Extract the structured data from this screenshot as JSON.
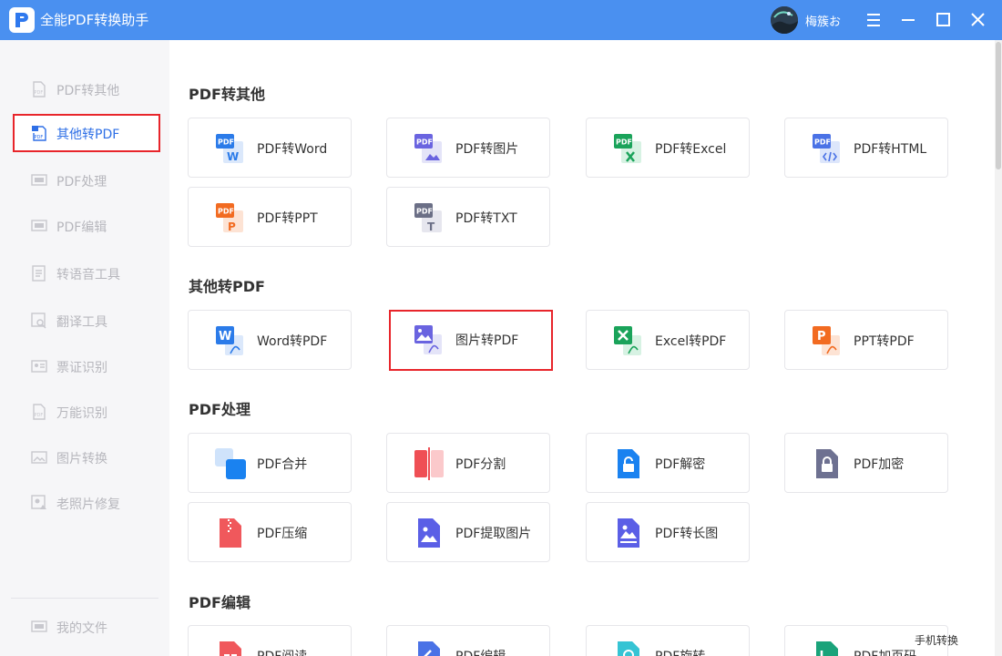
{
  "app": {
    "title": "全能PDF转换助手",
    "user_name": "梅簇お",
    "colors": {
      "title_bar": "#4a90f0",
      "accent": "#2e6fe6",
      "highlight_border": "#e8252b"
    }
  },
  "sidebar": {
    "items": [
      {
        "label": "PDF转其他",
        "icon": "pdf-file-icon"
      },
      {
        "label": "其他转PDF",
        "icon": "pdf-file-icon",
        "active": true
      },
      {
        "label": "PDF处理",
        "icon": "monitor-icon"
      },
      {
        "label": "PDF编辑",
        "icon": "monitor-icon"
      },
      {
        "label": "转语音工具",
        "icon": "document-icon"
      },
      {
        "label": "翻译工具",
        "icon": "image-search-icon"
      },
      {
        "label": "票证识别",
        "icon": "id-card-icon"
      },
      {
        "label": "万能识别",
        "icon": "pdf-file-icon"
      },
      {
        "label": "图片转换",
        "icon": "image-icon"
      },
      {
        "label": "老照片修复",
        "icon": "photo-icon"
      }
    ],
    "footer_item": {
      "label": "我的文件",
      "icon": "monitor-icon"
    }
  },
  "sections": [
    {
      "title": "PDF转其他",
      "cards": [
        {
          "label": "PDF转Word",
          "icon": "pdf-to-word-icon"
        },
        {
          "label": "PDF转图片",
          "icon": "pdf-to-image-icon"
        },
        {
          "label": "PDF转Excel",
          "icon": "pdf-to-excel-icon"
        },
        {
          "label": "PDF转HTML",
          "icon": "pdf-to-html-icon"
        },
        {
          "label": "PDF转PPT",
          "icon": "pdf-to-ppt-icon"
        },
        {
          "label": "PDF转TXT",
          "icon": "pdf-to-txt-icon"
        }
      ]
    },
    {
      "title": "其他转PDF",
      "cards": [
        {
          "label": "Word转PDF",
          "icon": "word-to-pdf-icon"
        },
        {
          "label": "图片转PDF",
          "icon": "image-to-pdf-icon",
          "highlight": true
        },
        {
          "label": "Excel转PDF",
          "icon": "excel-to-pdf-icon"
        },
        {
          "label": "PPT转PDF",
          "icon": "ppt-to-pdf-icon"
        }
      ]
    },
    {
      "title": "PDF处理",
      "cards": [
        {
          "label": "PDF合并",
          "icon": "merge-icon"
        },
        {
          "label": "PDF分割",
          "icon": "split-icon"
        },
        {
          "label": "PDF解密",
          "icon": "unlock-icon"
        },
        {
          "label": "PDF加密",
          "icon": "lock-icon"
        },
        {
          "label": "PDF压缩",
          "icon": "compress-icon"
        },
        {
          "label": "PDF提取图片",
          "icon": "extract-image-icon"
        },
        {
          "label": "PDF转长图",
          "icon": "long-image-icon"
        }
      ]
    },
    {
      "title": "PDF编辑",
      "cards": [
        {
          "label": "PDF阅读",
          "icon": "read-icon"
        },
        {
          "label": "PDF编辑",
          "icon": "edit-icon"
        },
        {
          "label": "PDF旋转",
          "icon": "rotate-icon"
        },
        {
          "label": "PDF加页码",
          "icon": "page-number-icon"
        }
      ]
    }
  ],
  "footer": {
    "mobile_link": "手机转换"
  }
}
